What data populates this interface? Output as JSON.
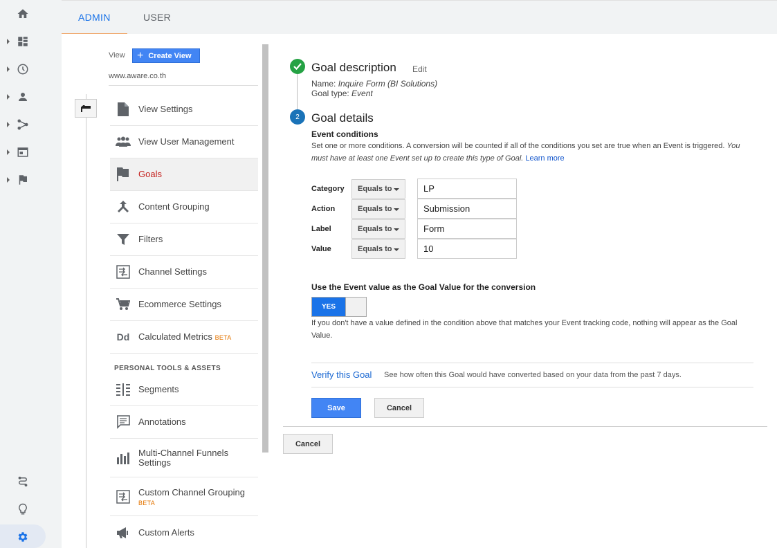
{
  "tabs": {
    "admin": "ADMIN",
    "user": "USER"
  },
  "rail_icons": [
    "home-icon",
    "dashboard-icon",
    "clock-icon",
    "person-icon",
    "acquisition-icon",
    "behavior-icon",
    "flag-icon",
    "route-icon",
    "lightbulb-icon",
    "gear-icon"
  ],
  "view": {
    "label": "View",
    "create_button": "Create View",
    "url": "www.aware.co.th"
  },
  "nav": {
    "items": [
      {
        "label": "View Settings",
        "icon": "document-icon"
      },
      {
        "label": "View User Management",
        "icon": "people-icon"
      },
      {
        "label": "Goals",
        "icon": "flag-icon"
      },
      {
        "label": "Content Grouping",
        "icon": "grouping-icon"
      },
      {
        "label": "Filters",
        "icon": "filter-icon"
      },
      {
        "label": "Channel Settings",
        "icon": "channel-icon"
      },
      {
        "label": "Ecommerce Settings",
        "icon": "cart-icon"
      },
      {
        "label": "Calculated Metrics",
        "icon": "dd-icon",
        "badge": "BETA"
      }
    ],
    "section_title": "PERSONAL TOOLS & ASSETS",
    "tools": [
      {
        "label": "Segments",
        "icon": "segments-icon"
      },
      {
        "label": "Annotations",
        "icon": "annotation-icon"
      },
      {
        "label": "Multi-Channel Funnels",
        "label2": "Settings",
        "icon": "bar-chart-icon"
      },
      {
        "label": "Custom Channel Grouping",
        "badge": "BETA",
        "icon": "channel-icon"
      },
      {
        "label": "Custom Alerts",
        "icon": "megaphone-icon"
      }
    ],
    "dd_text": "Dd"
  },
  "goal_description": {
    "title": "Goal description",
    "edit": "Edit",
    "name_label": "Name: ",
    "name_value": "Inquire Form (BI Solutions)",
    "type_label": "Goal type: ",
    "type_value": "Event"
  },
  "goal_details": {
    "step_number": "2",
    "title": "Goal details",
    "event_conditions_title": "Event conditions",
    "description": "Set one or more conditions. A conversion will be counted if all of the conditions you set are true when an Event is triggered. ",
    "description_italic": "You must have at least one Event set up to create this type of Goal.",
    "learn_more": "Learn more",
    "conditions": [
      {
        "label": "Category",
        "operator": "Equals to",
        "value": "LP"
      },
      {
        "label": "Action",
        "operator": "Equals to",
        "value": "Submission"
      },
      {
        "label": "Label",
        "operator": "Equals to",
        "value": "Form"
      },
      {
        "label": "Value",
        "operator": "Equals to",
        "value": "10"
      }
    ],
    "use_value_title": "Use the Event value as the Goal Value for the conversion",
    "toggle_label": "YES",
    "toggle_note": "If you don't have a value defined in the condition above that matches your Event tracking code, nothing will appear as the Goal Value.",
    "verify_link": "Verify this Goal",
    "verify_desc": "See how often this Goal would have converted based on your data from the past 7 days.",
    "save": "Save",
    "cancel": "Cancel"
  },
  "footer_cancel": "Cancel",
  "colors": {
    "accent": "#1a73e8",
    "goals_active": "#c5221f",
    "beta": "#e37400",
    "check": "#25a244"
  }
}
